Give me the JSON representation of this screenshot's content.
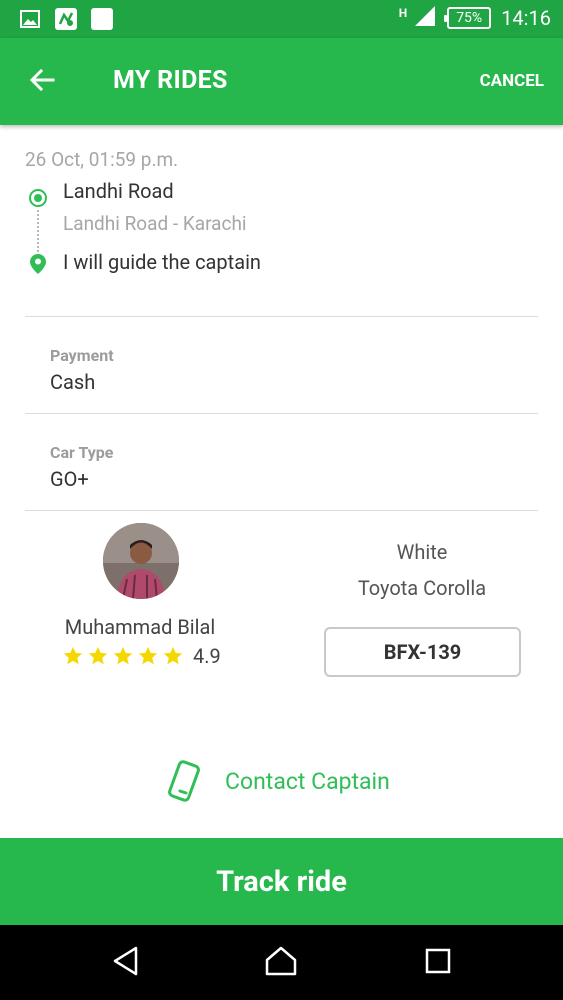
{
  "status_bar": {
    "network_type": "H",
    "battery": "75%",
    "time": "14:16",
    "icons": [
      "gallery-icon",
      "app-notification-icon",
      "blank-notification-icon",
      "signal-icon",
      "battery-icon"
    ]
  },
  "app_bar": {
    "title": "MY RIDES",
    "cancel_label": "CANCEL",
    "back_icon": "arrow-left-icon"
  },
  "ride": {
    "date": "26 Oct, 01:59 p.m.",
    "pickup_title": "Landhi Road",
    "pickup_subtitle": "Landhi Road - Karachi",
    "dropoff_title": "I will guide the captain"
  },
  "payment": {
    "label": "Payment",
    "value": "Cash"
  },
  "car_type": {
    "label": "Car Type",
    "value": "GO+"
  },
  "captain": {
    "name": "Muhammad Bilal",
    "rating": "4.9",
    "stars": 5
  },
  "vehicle": {
    "color": "White",
    "model": "Toyota Corolla",
    "plate": "BFX-139"
  },
  "contact": {
    "label": "Contact Captain",
    "icon": "phone-icon"
  },
  "track_button": "Track ride",
  "colors": {
    "status_bar": "#1fa544",
    "primary": "#26b84c",
    "accent_text": "#2fbf56",
    "star": "#f5d800"
  }
}
